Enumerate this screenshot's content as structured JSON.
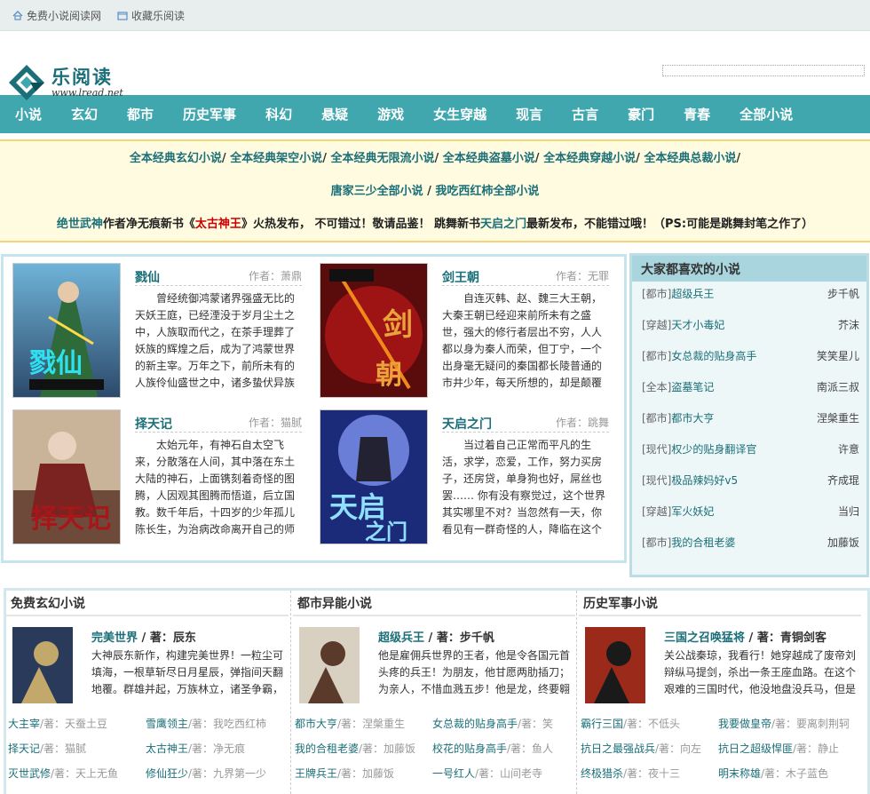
{
  "topbar": {
    "link1": "免费小说阅读网",
    "link2": "收藏乐阅读"
  },
  "logo": {
    "cn": "乐阅读",
    "en": "www.lread.net"
  },
  "nav": [
    "小说",
    "玄幻",
    "都市",
    "历史军事",
    "科幻",
    "悬疑",
    "游戏",
    "女生穿越",
    "现言",
    "古言",
    "豪门",
    "青春",
    "全部小说"
  ],
  "notice": {
    "row1": [
      "全本经典玄幻小说",
      "全本经典架空小说",
      "全本经典无限流小说",
      "全本经典盗墓小说",
      "全本经典穿越小说",
      "全本经典总裁小说"
    ],
    "row2": [
      "唐家三少全部小说",
      "我吃西红柿全部小说"
    ],
    "row3": {
      "a": "绝世武神",
      "b": "作者净无痕新书《",
      "c": "太古神王",
      "d": "》火热发布， 不可错过！敬请品鉴！ 跳舞新书",
      "e": "天启之门",
      "f": "最新发布，不能错过哦！（PS:可能是跳舞封笔之作了）"
    }
  },
  "featured": [
    {
      "title": "戮仙",
      "author": "作者：萧鼎",
      "desc": "曾经统御鸿蒙诸界强盛无比的天妖王庭，已经湮没于岁月尘土之中，人族取而代之，在茶手理葬了妖族的辉煌之后，成为了鸿蒙世界的新主宰。万年之下，前所未有的人族伶仙盛世之中，诸多蛰伏异族"
    },
    {
      "title": "剑王朝",
      "author": "作者：无罪",
      "desc": "自连灭韩、赵、魏三大王朝，大秦王朝已经迎来前所未有之盛世，强大的修行者层出不穷，人人都以身为秦人而荣，但丁宁，一个出身毫无疑问的秦国都长陵普通的市井少年，每天所想的，却是颠覆"
    },
    {
      "title": "择天记",
      "author": "作者：猫腻",
      "desc": "太始元年，有神石自太空飞来，分散落在人间，其中落在东土大陆的神石，上面镌刻着奇怪的图腾，人因观其图腾而悟道，后立国教。数千年后，十四岁的少年孤儿陈长生，为治病改命离开自己的师"
    },
    {
      "title": "天启之门",
      "author": "作者：跳舞",
      "desc": "当过着自己正常而平凡的生活，求学，恋爱，工作，努力买房子，还房贷，单身狗也好，屌丝也罢…… 你有没有察觉过，这个世界其实哪里不对？当忽然有一天，你看见有一群奇怪的人，降临在这个"
    }
  ],
  "sidebar": {
    "title": "大家都喜欢的小说",
    "items": [
      {
        "cat": "[都市]",
        "name": "超级兵王",
        "author": "步千帆"
      },
      {
        "cat": "[穿越]",
        "name": "天才小毒妃",
        "author": "芥沫"
      },
      {
        "cat": "[都市]",
        "name": "女总裁的贴身高手",
        "author": "笑笑星儿"
      },
      {
        "cat": "[全本]",
        "name": "盗墓笔记",
        "author": "南派三叔"
      },
      {
        "cat": "[都市]",
        "name": "都市大亨",
        "author": "涅槃重生"
      },
      {
        "cat": "[现代]",
        "name": "权少的贴身翻译官",
        "author": "许意"
      },
      {
        "cat": "[现代]",
        "name": "极品辣妈好v5",
        "author": "齐成琨"
      },
      {
        "cat": "[穿越]",
        "name": "军火妖妃",
        "author": "当归"
      },
      {
        "cat": "[都市]",
        "name": "我的合租老婆",
        "author": "加藤饭"
      }
    ]
  },
  "columns": [
    {
      "header": "免费玄幻小说",
      "ftitle": "完美世界",
      "fsep": " / 著：",
      "fauthor": "辰东",
      "fdesc": "大神辰东新作，构建完美世界！一粒尘可填海，一根草斩尽日月星辰，弹指间天翻地覆。群雄并起，万族林立，诸圣争霸，",
      "list": [
        [
          "大主宰",
          "/著：天蚕土豆"
        ],
        [
          "雪鹰领主",
          "/著：我吃西红柿"
        ],
        [
          "择天记",
          "/著：猫腻"
        ],
        [
          "太古神王",
          "/著：净无痕"
        ],
        [
          "灭世武修",
          "/著：天上无鱼"
        ],
        [
          "修仙狂少",
          "/著：九界第一少"
        ]
      ]
    },
    {
      "header": "都市异能小说",
      "ftitle": "超级兵王",
      "fsep": " / 著：",
      "fauthor": "步千帆",
      "fdesc": "他是雇佣兵世界的王者，他是令各国元首头疼的兵王！为朋友，他甘愿两肋插刀；为亲人，不惜血溅五步！他是龙，终要翱翔",
      "list": [
        [
          "都市大亨",
          "/著：涅槃重生"
        ],
        [
          "女总裁的贴身高手",
          "/著：笑"
        ],
        [
          "我的合租老婆",
          "/著：加藤饭"
        ],
        [
          "校花的贴身高手",
          "/著：鱼人"
        ],
        [
          "王牌兵王",
          "/著：加藤饭"
        ],
        [
          "一号红人",
          "/著：山间老寺"
        ]
      ]
    },
    {
      "header": "历史军事小说",
      "ftitle": "三国之召唤猛将",
      "fsep": " / 著：",
      "fauthor": "青铜剑客",
      "fdesc": "关公战秦琼，我看行！她穿越成了废帝刘辩纵马提剑，杀出一条王座血路。在这个艰难的三国时代，他没地盘没兵马，但是",
      "list": [
        [
          "霸行三国",
          "/著：不低头"
        ],
        [
          "我要做皇帝",
          "/著：要离刺荆轲"
        ],
        [
          "抗日之最强战兵",
          "/著：向左"
        ],
        [
          "抗日之超级悍匪",
          "/著：静止"
        ],
        [
          "终极猎杀",
          "/著：夜十三"
        ],
        [
          "明末称雄",
          "/著：木子蓝色"
        ]
      ]
    }
  ]
}
